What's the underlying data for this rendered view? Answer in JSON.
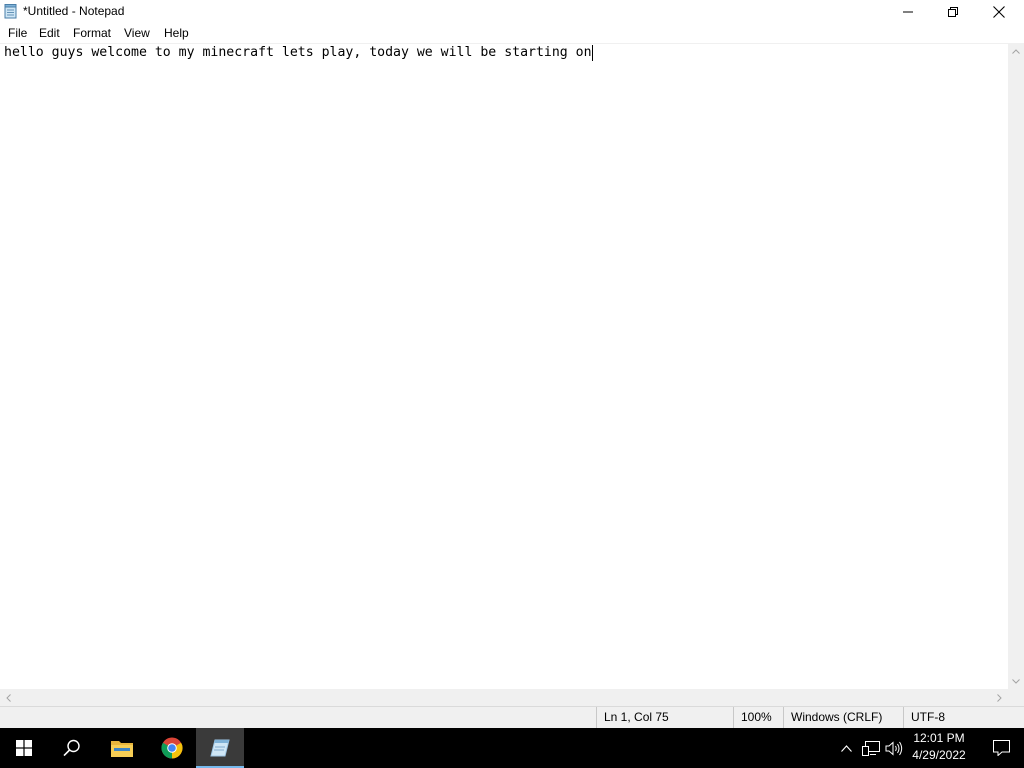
{
  "window": {
    "title": "*Untitled - Notepad",
    "icon": "notepad-icon",
    "controls": [
      "minimize-icon",
      "restore-icon",
      "close-icon"
    ]
  },
  "menu": {
    "items": [
      "File",
      "Edit",
      "Format",
      "View",
      "Help"
    ]
  },
  "editor": {
    "content": "hello guys welcome to my minecraft lets play, today we will be starting on"
  },
  "statusbar": {
    "position": "Ln 1, Col 75",
    "zoom": "100%",
    "line_ending": "Windows (CRLF)",
    "encoding": "UTF-8"
  },
  "taskbar": {
    "pinned": [
      "windows-start-icon",
      "search-icon",
      "file-explorer-icon",
      "chrome-icon",
      "notepad-icon"
    ],
    "active": "notepad-icon",
    "tray_icons": [
      "chevron-up-icon",
      "network-icon",
      "volume-icon"
    ],
    "time": "12:01 PM",
    "date": "4/29/2022",
    "accent": "#76b9ed"
  }
}
